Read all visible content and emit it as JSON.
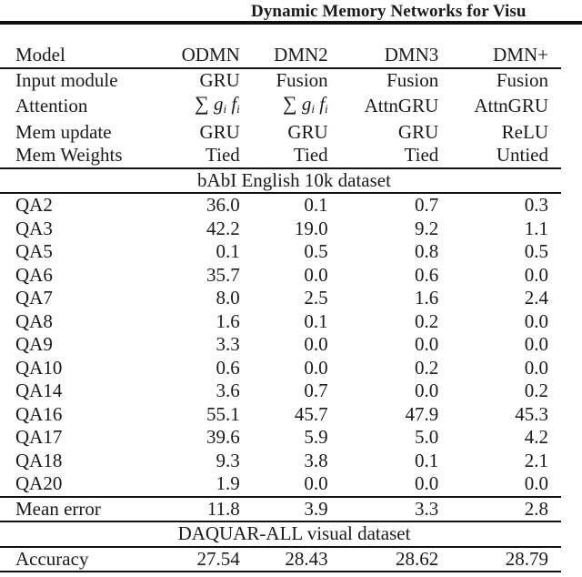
{
  "running_head": {
    "title": "Dynamic Memory Networks for Visu"
  },
  "table": {
    "columns": [
      "Model",
      "ODMN",
      "DMN2",
      "DMN3",
      "DMN+"
    ],
    "config_rows": [
      {
        "label": "Input module",
        "values": [
          "GRU",
          "Fusion",
          "Fusion",
          "Fusion"
        ]
      },
      {
        "label": "Attention",
        "values": [
          "∑ gᵢ fᵢ",
          "∑ gᵢ fᵢ",
          "AttnGRU",
          "AttnGRU"
        ]
      },
      {
        "label": "Mem update",
        "values": [
          "GRU",
          "GRU",
          "GRU",
          "ReLU"
        ]
      },
      {
        "label": "Mem Weights",
        "values": [
          "Tied",
          "Tied",
          "Tied",
          "Untied"
        ]
      }
    ],
    "attention_math": {
      "sum": "∑",
      "g": "g",
      "f": "f",
      "i": "i"
    },
    "babi_section_title": "bAbI English 10k dataset",
    "babi_rows": [
      {
        "label": "QA2",
        "values": [
          "36.0",
          "0.1",
          "0.7",
          "0.3"
        ]
      },
      {
        "label": "QA3",
        "values": [
          "42.2",
          "19.0",
          "9.2",
          "1.1"
        ]
      },
      {
        "label": "QA5",
        "values": [
          "0.1",
          "0.5",
          "0.8",
          "0.5"
        ]
      },
      {
        "label": "QA6",
        "values": [
          "35.7",
          "0.0",
          "0.6",
          "0.0"
        ]
      },
      {
        "label": "QA7",
        "values": [
          "8.0",
          "2.5",
          "1.6",
          "2.4"
        ]
      },
      {
        "label": "QA8",
        "values": [
          "1.6",
          "0.1",
          "0.2",
          "0.0"
        ]
      },
      {
        "label": "QA9",
        "values": [
          "3.3",
          "0.0",
          "0.0",
          "0.0"
        ]
      },
      {
        "label": "QA10",
        "values": [
          "0.6",
          "0.0",
          "0.2",
          "0.0"
        ]
      },
      {
        "label": "QA14",
        "values": [
          "3.6",
          "0.7",
          "0.0",
          "0.2"
        ]
      },
      {
        "label": "QA16",
        "values": [
          "55.1",
          "45.7",
          "47.9",
          "45.3"
        ]
      },
      {
        "label": "QA17",
        "values": [
          "39.6",
          "5.9",
          "5.0",
          "4.2"
        ]
      },
      {
        "label": "QA18",
        "values": [
          "9.3",
          "3.8",
          "0.1",
          "2.1"
        ]
      },
      {
        "label": "QA20",
        "values": [
          "1.9",
          "0.0",
          "0.0",
          "0.0"
        ]
      }
    ],
    "mean_error": {
      "label": "Mean error",
      "values": [
        "11.8",
        "3.9",
        "3.3",
        "2.8"
      ]
    },
    "daquar_section_title": "DAQUAR-ALL visual dataset",
    "accuracy": {
      "label": "Accuracy",
      "values": [
        "27.54",
        "28.43",
        "28.62",
        "28.79"
      ]
    }
  }
}
